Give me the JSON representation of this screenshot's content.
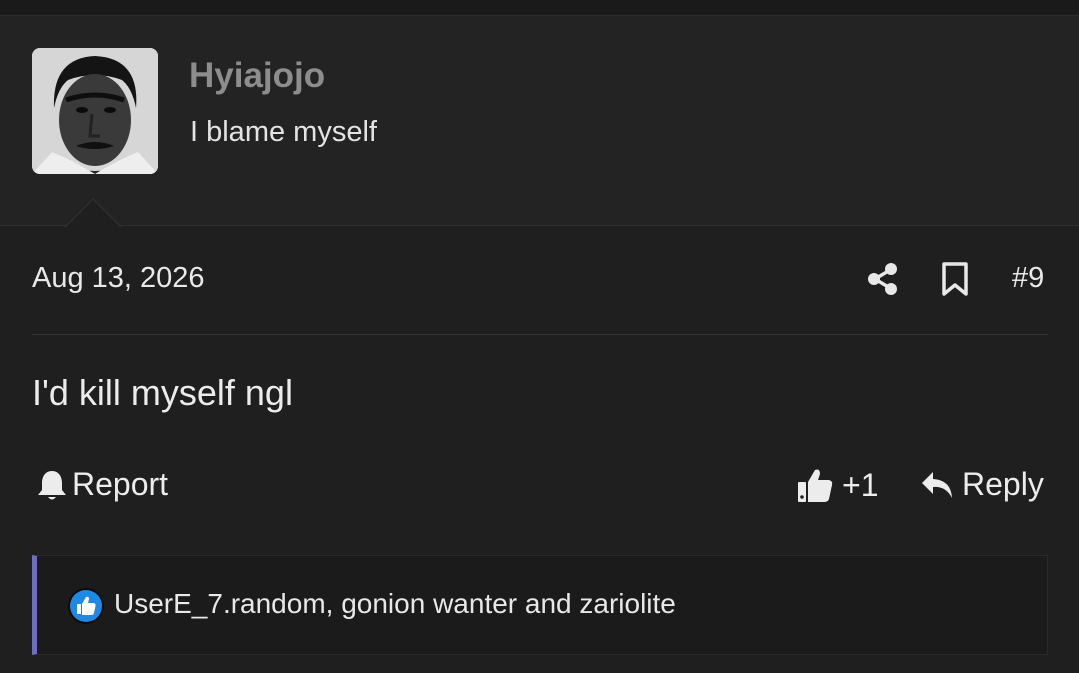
{
  "post": {
    "username": "Hyiajojo",
    "user_title": "I blame myself",
    "date": "Aug 13, 2026",
    "post_number": "#9",
    "message": "I'd kill myself ngl"
  },
  "actions": {
    "report_label": "Report",
    "like_count": "+1",
    "reply_label": "Reply"
  },
  "reactions": {
    "text": "UserE_7.random, gonion wanter and zariolite"
  },
  "colors": {
    "background": "#1f1f1f",
    "username": "#8d8d8d",
    "reaction_accent": "#6b6fc0",
    "like_badge": "#1e88e5"
  },
  "icons": [
    "share-icon",
    "bookmark-icon",
    "bell-icon",
    "thumbs-up-icon",
    "reply-arrow-icon",
    "like-reaction-icon"
  ]
}
